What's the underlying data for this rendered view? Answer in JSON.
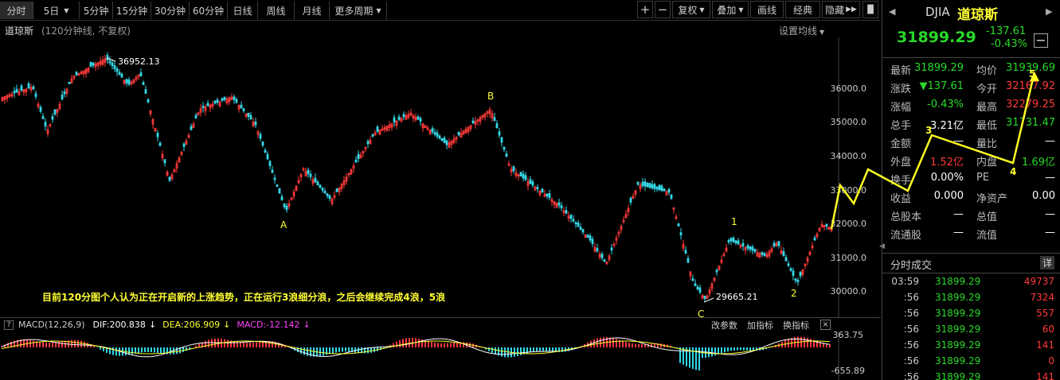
{
  "toolbar": {
    "periods": [
      "分时",
      "5日",
      "5分钟",
      "15分钟",
      "30分钟",
      "60分钟",
      "日线",
      "周线",
      "月线",
      "更多周期"
    ],
    "right": [
      "复权",
      "叠加",
      "画线",
      "经典",
      "隐藏"
    ]
  },
  "sub": {
    "name": "道琼斯",
    "desc": "(120分钟线, 不复权)",
    "ma_setting": "设置均线"
  },
  "price_axis": [
    "36000.0",
    "35000.0",
    "34000.0",
    "33000.0",
    "32000.0",
    "31000.0",
    "30000.0"
  ],
  "annotations": {
    "high": "36952.13",
    "low": "29665.21",
    "A": "A",
    "B": "B",
    "C": "C",
    "w1": "1",
    "w2": "2",
    "w3": "3",
    "w4": "4",
    "w5": "5",
    "note": "目前120分图个人认为正在开启新的上涨趋势，正在运行3浪细分浪，之后会继续完成4浪，5浪"
  },
  "macd": {
    "label": "MACD(12,26,9)",
    "dif": "DIF:200.838",
    "dea": "DEA:206.909",
    "macd": "MACD:-12.142",
    "buttons": [
      "改参数",
      "加指标",
      "换指标"
    ],
    "axis_top": "363.75",
    "axis_bottom": "-655.89"
  },
  "quote": {
    "code": "DJIA",
    "name": "道琼斯",
    "price": "31899.29",
    "change": "-137.61",
    "pct": "-0.43%"
  },
  "stats": [
    {
      "l": "最新",
      "v": "31899.29",
      "c": "grn",
      "l2": "均价",
      "v2": "31939.69",
      "c2": "grn"
    },
    {
      "l": "涨跌",
      "v": "▼137.61",
      "c": "grn",
      "l2": "今开",
      "v2": "32167.92",
      "c2": "red"
    },
    {
      "l": "涨幅",
      "v": "-0.43%",
      "c": "grn",
      "l2": "最高",
      "v2": "32279.25",
      "c2": "red"
    },
    {
      "l": "总手",
      "v": "3.21亿",
      "c": "wht",
      "l2": "最低",
      "v2": "31731.47",
      "c2": "grn"
    },
    {
      "l": "金额",
      "v": "—",
      "c": "wht",
      "l2": "量比",
      "v2": "—",
      "c2": "wht"
    },
    {
      "l": "外盘",
      "v": "1.52亿",
      "c": "red",
      "l2": "内盘",
      "v2": "1.69亿",
      "c2": "grn"
    },
    {
      "l": "换手",
      "v": "0.00%",
      "c": "wht",
      "l2": "PE",
      "v2": "—",
      "c2": "wht"
    },
    {
      "l": "收益",
      "v": "0.000",
      "c": "wht",
      "l2": "净资产",
      "v2": "0.00",
      "c2": "wht"
    },
    {
      "l": "总股本",
      "v": "—",
      "c": "wht",
      "l2": "总值",
      "v2": "—",
      "c2": "wht"
    },
    {
      "l": "流通股",
      "v": "—",
      "c": "wht",
      "l2": "流值",
      "v2": "—",
      "c2": "wht"
    }
  ],
  "trades_title": "分时成交",
  "trades_btn": "详",
  "trades": [
    {
      "t": "03:59",
      "p": "31899.29",
      "v": "49737"
    },
    {
      "t": ":56",
      "p": "31899.29",
      "v": "7324"
    },
    {
      "t": ":56",
      "p": "31899.29",
      "v": "557"
    },
    {
      "t": ":56",
      "p": "31899.29",
      "v": "60"
    },
    {
      "t": ":56",
      "p": "31899.29",
      "v": "141"
    },
    {
      "t": ":56",
      "p": "31899.29",
      "v": "0"
    },
    {
      "t": ":56",
      "p": "31899.29",
      "v": "141"
    }
  ]
}
